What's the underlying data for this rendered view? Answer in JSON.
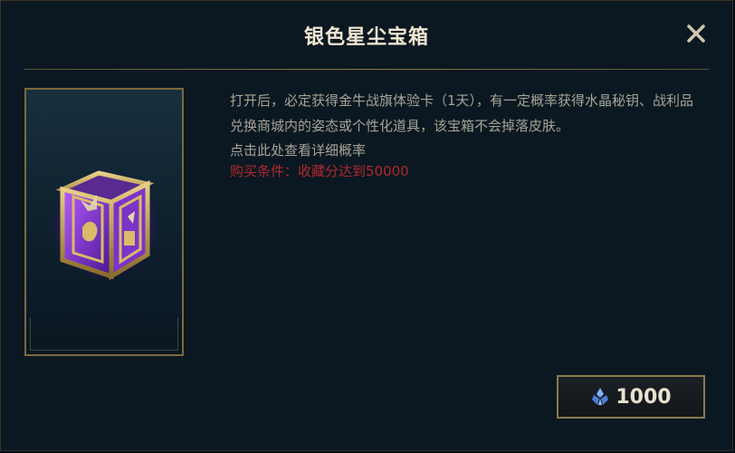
{
  "dialog": {
    "title": "银色星尘宝箱"
  },
  "description": {
    "text": "打开后，必定获得金牛战旗体验卡（1天），有一定概率获得水晶秘钥、战利品兑换商城内的姿态或个性化道具，该宝箱不会掉落皮肤。",
    "link": "点击此处查看详细概率",
    "condition": "购买条件：收藏分达到50000"
  },
  "purchase": {
    "price": "1000",
    "currency_icon": "blue-essence-icon"
  },
  "icons": {
    "close": "close-icon"
  },
  "colors": {
    "title": "#f0e6d2",
    "body_text": "#a6a397",
    "condition": "#b0282e",
    "gold_border": "#8a7a4e",
    "currency": "#5a8bd6"
  }
}
